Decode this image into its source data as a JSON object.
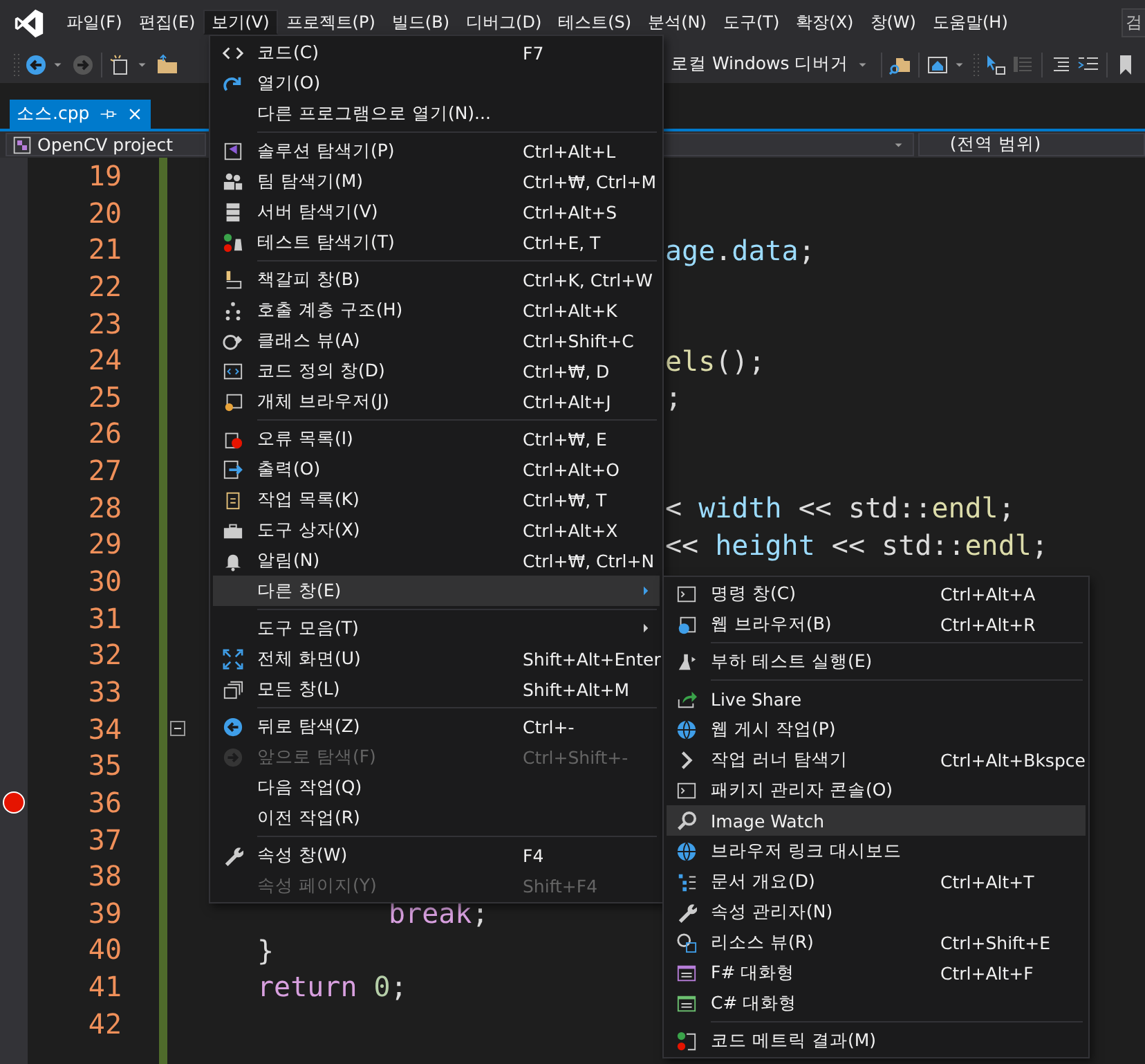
{
  "menubar": {
    "items": [
      {
        "label": "파일(F)",
        "selected": false
      },
      {
        "label": "편집(E)",
        "selected": false
      },
      {
        "label": "보기(V)",
        "selected": true
      },
      {
        "label": "프로젝트(P)",
        "selected": false
      },
      {
        "label": "빌드(B)",
        "selected": false
      },
      {
        "label": "디버그(D)",
        "selected": false
      },
      {
        "label": "테스트(S)",
        "selected": false
      },
      {
        "label": "분석(N)",
        "selected": false
      },
      {
        "label": "도구(T)",
        "selected": false
      },
      {
        "label": "확장(X)",
        "selected": false
      },
      {
        "label": "창(W)",
        "selected": false
      },
      {
        "label": "도움말(H)",
        "selected": false
      }
    ],
    "search": "검"
  },
  "toolbar": {
    "debugger": "로컬 Windows 디버거"
  },
  "tabs": [
    {
      "label": "소스.cpp",
      "selected": true
    }
  ],
  "navbar": {
    "project": "OpenCV project",
    "scope": "(전역 범위)"
  },
  "editor": {
    "lines": [
      {
        "number": "19",
        "breakpoint": false,
        "foldable": false
      },
      {
        "number": "20",
        "breakpoint": false,
        "foldable": false
      },
      {
        "number": "21",
        "breakpoint": false,
        "foldable": false,
        "kind": "tail",
        "tokens": [
          {
            "text": "age",
            "kind": "member"
          },
          {
            "text": ".",
            "kind": "plain"
          },
          {
            "text": "data",
            "kind": "member"
          },
          {
            "text": ";",
            "kind": "plain"
          }
        ]
      },
      {
        "number": "22",
        "breakpoint": false,
        "foldable": false
      },
      {
        "number": "23",
        "breakpoint": false,
        "foldable": false
      },
      {
        "number": "24",
        "breakpoint": false,
        "foldable": false,
        "kind": "tail",
        "tokens": [
          {
            "text": "els",
            "kind": "func"
          },
          {
            "text": "();",
            "kind": "plain"
          }
        ]
      },
      {
        "number": "25",
        "breakpoint": false,
        "foldable": false,
        "kind": "tail",
        "tokens": [
          {
            "text": ";",
            "kind": "plain"
          }
        ]
      },
      {
        "number": "26",
        "breakpoint": false,
        "foldable": false
      },
      {
        "number": "27",
        "breakpoint": false,
        "foldable": false
      },
      {
        "number": "28",
        "breakpoint": false,
        "foldable": false,
        "kind": "tail",
        "tokens": [
          {
            "text": "< ",
            "kind": "plain"
          },
          {
            "text": "width",
            "kind": "member"
          },
          {
            "text": " << std::",
            "kind": "plain"
          },
          {
            "text": "endl",
            "kind": "func"
          },
          {
            "text": ";",
            "kind": "plain"
          }
        ]
      },
      {
        "number": "29",
        "breakpoint": false,
        "foldable": false,
        "kind": "tail",
        "tokens": [
          {
            "text": "<< ",
            "kind": "plain"
          },
          {
            "text": "height",
            "kind": "member"
          },
          {
            "text": " << std::",
            "kind": "plain"
          },
          {
            "text": "endl",
            "kind": "func"
          },
          {
            "text": ";",
            "kind": "plain"
          }
        ]
      },
      {
        "number": "30",
        "breakpoint": false,
        "foldable": false
      },
      {
        "number": "31",
        "breakpoint": false,
        "foldable": false
      },
      {
        "number": "32",
        "breakpoint": false,
        "foldable": false
      },
      {
        "number": "33",
        "breakpoint": false,
        "foldable": false
      },
      {
        "number": "34",
        "breakpoint": false,
        "foldable": true
      },
      {
        "number": "35",
        "breakpoint": false,
        "foldable": false
      },
      {
        "number": "36",
        "breakpoint": true,
        "foldable": false
      },
      {
        "number": "37",
        "breakpoint": false,
        "foldable": false
      },
      {
        "number": "38",
        "breakpoint": false,
        "foldable": false
      },
      {
        "number": "39",
        "breakpoint": false,
        "foldable": false,
        "kind": "inner",
        "tokens": [
          {
            "text": "break",
            "kind": "keyword"
          },
          {
            "text": ";",
            "kind": "plain"
          }
        ]
      },
      {
        "number": "40",
        "breakpoint": false,
        "foldable": false,
        "kind": "block",
        "tokens": [
          {
            "text": "}",
            "kind": "plain"
          }
        ]
      },
      {
        "number": "41",
        "breakpoint": false,
        "foldable": false,
        "kind": "block",
        "tokens": [
          {
            "text": "return ",
            "kind": "keyword"
          },
          {
            "text": "0",
            "kind": "number"
          },
          {
            "text": ";",
            "kind": "plain"
          }
        ]
      },
      {
        "number": "42",
        "breakpoint": false,
        "foldable": false
      }
    ]
  },
  "view_menu": {
    "groups": [
      [
        {
          "label": "코드(C)",
          "shortcut": "F7",
          "disabled": false,
          "selected": false,
          "submenu": false
        },
        {
          "label": "열기(O)",
          "disabled": false,
          "selected": false,
          "submenu": false
        },
        {
          "label": "다른 프로그램으로 열기(N)...",
          "disabled": false,
          "selected": false,
          "submenu": false
        }
      ],
      [
        {
          "label": "솔루션 탐색기(P)",
          "shortcut": "Ctrl+Alt+L",
          "disabled": false,
          "selected": false,
          "submenu": false
        },
        {
          "label": "팀 탐색기(M)",
          "shortcut": "Ctrl+₩, Ctrl+M",
          "disabled": false,
          "selected": false,
          "submenu": false
        },
        {
          "label": "서버 탐색기(V)",
          "shortcut": "Ctrl+Alt+S",
          "disabled": false,
          "selected": false,
          "submenu": false
        },
        {
          "label": "테스트 탐색기(T)",
          "shortcut": "Ctrl+E, T",
          "disabled": false,
          "selected": false,
          "submenu": false
        }
      ],
      [
        {
          "label": "책갈피 창(B)",
          "shortcut": "Ctrl+K, Ctrl+W",
          "disabled": false,
          "selected": false,
          "submenu": false
        },
        {
          "label": "호출 계층 구조(H)",
          "shortcut": "Ctrl+Alt+K",
          "disabled": false,
          "selected": false,
          "submenu": false
        },
        {
          "label": "클래스 뷰(A)",
          "shortcut": "Ctrl+Shift+C",
          "disabled": false,
          "selected": false,
          "submenu": false
        },
        {
          "label": "코드 정의 창(D)",
          "shortcut": "Ctrl+₩, D",
          "disabled": false,
          "selected": false,
          "submenu": false
        },
        {
          "label": "개체 브라우저(J)",
          "shortcut": "Ctrl+Alt+J",
          "disabled": false,
          "selected": false,
          "submenu": false
        }
      ],
      [
        {
          "label": "오류 목록(I)",
          "shortcut": "Ctrl+₩, E",
          "disabled": false,
          "selected": false,
          "submenu": false
        },
        {
          "label": "출력(O)",
          "shortcut": "Ctrl+Alt+O",
          "disabled": false,
          "selected": false,
          "submenu": false
        },
        {
          "label": "작업 목록(K)",
          "shortcut": "Ctrl+₩, T",
          "disabled": false,
          "selected": false,
          "submenu": false
        },
        {
          "label": "도구 상자(X)",
          "shortcut": "Ctrl+Alt+X",
          "disabled": false,
          "selected": false,
          "submenu": false
        },
        {
          "label": "알림(N)",
          "shortcut": "Ctrl+₩, Ctrl+N",
          "disabled": false,
          "selected": false,
          "submenu": false
        },
        {
          "label": "다른 창(E)",
          "disabled": false,
          "selected": true,
          "submenu": true
        }
      ],
      [
        {
          "label": "도구 모음(T)",
          "disabled": false,
          "selected": false,
          "submenu": true
        },
        {
          "label": "전체 화면(U)",
          "shortcut": "Shift+Alt+Enter",
          "disabled": false,
          "selected": false,
          "submenu": false
        },
        {
          "label": "모든 창(L)",
          "shortcut": "Shift+Alt+M",
          "disabled": false,
          "selected": false,
          "submenu": false
        }
      ],
      [
        {
          "label": "뒤로 탐색(Z)",
          "shortcut": "Ctrl+-",
          "disabled": false,
          "selected": false,
          "submenu": false
        },
        {
          "label": "앞으로 탐색(F)",
          "shortcut": "Ctrl+Shift+-",
          "disabled": true,
          "selected": false,
          "submenu": false
        },
        {
          "label": "다음 작업(Q)",
          "disabled": false,
          "selected": false,
          "submenu": false
        },
        {
          "label": "이전 작업(R)",
          "disabled": false,
          "selected": false,
          "submenu": false
        }
      ],
      [
        {
          "label": "속성 창(W)",
          "shortcut": "F4",
          "disabled": false,
          "selected": false,
          "submenu": false
        },
        {
          "label": "속성 페이지(Y)",
          "shortcut": "Shift+F4",
          "disabled": true,
          "selected": false,
          "submenu": false
        }
      ]
    ]
  },
  "other_windows_menu": {
    "groups": [
      [
        {
          "label": "명령 창(C)",
          "shortcut": "Ctrl+Alt+A",
          "disabled": false,
          "selected": false,
          "submenu": false
        },
        {
          "label": "웹 브라우저(B)",
          "shortcut": "Ctrl+Alt+R",
          "disabled": false,
          "selected": false,
          "submenu": false
        }
      ],
      [
        {
          "label": "부하 테스트 실행(E)",
          "disabled": false,
          "selected": false,
          "submenu": false
        }
      ],
      [
        {
          "label": "Live Share",
          "disabled": false,
          "selected": false,
          "submenu": false
        },
        {
          "label": "웹 게시 작업(P)",
          "disabled": false,
          "selected": false,
          "submenu": false
        },
        {
          "label": "작업 러너 탐색기",
          "shortcut": "Ctrl+Alt+Bkspce",
          "disabled": false,
          "selected": false,
          "submenu": false
        },
        {
          "label": "패키지 관리자 콘솔(O)",
          "disabled": false,
          "selected": false,
          "submenu": false
        },
        {
          "label": "Image Watch",
          "disabled": false,
          "selected": true,
          "submenu": false
        },
        {
          "label": "브라우저 링크 대시보드",
          "disabled": false,
          "selected": false,
          "submenu": false
        },
        {
          "label": "문서 개요(D)",
          "shortcut": "Ctrl+Alt+T",
          "disabled": false,
          "selected": false,
          "submenu": false
        },
        {
          "label": "속성 관리자(N)",
          "disabled": false,
          "selected": false,
          "submenu": false
        },
        {
          "label": "리소스 뷰(R)",
          "shortcut": "Ctrl+Shift+E",
          "disabled": false,
          "selected": false,
          "submenu": false
        },
        {
          "label": "F# 대화형",
          "shortcut": "Ctrl+Alt+F",
          "disabled": false,
          "selected": false,
          "submenu": false
        },
        {
          "label": "C# 대화형",
          "disabled": false,
          "selected": false,
          "submenu": false
        }
      ],
      [
        {
          "label": "코드 메트릭 결과(M)",
          "disabled": false,
          "selected": false,
          "submenu": false
        }
      ]
    ]
  }
}
